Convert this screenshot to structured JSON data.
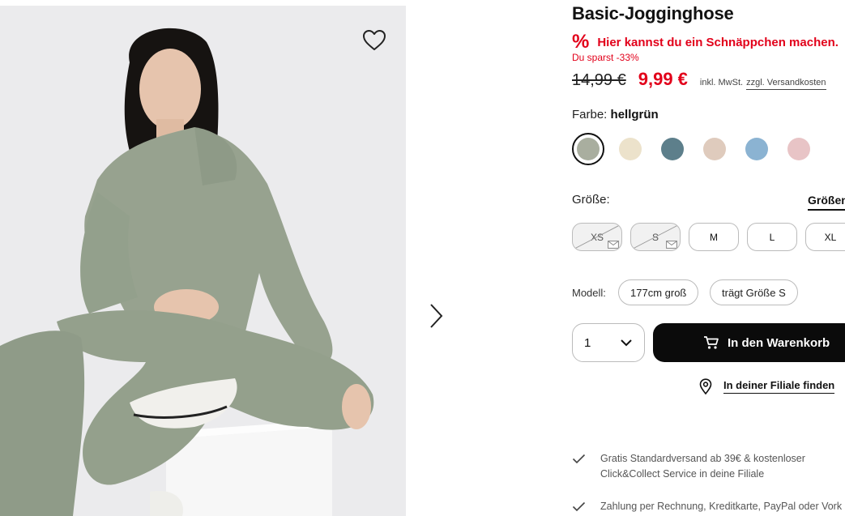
{
  "product": {
    "title": "Basic-Jogginghose",
    "deal_text": "Hier kannst du ein Schnäppchen machen.",
    "savings_text": "Du sparst -33%",
    "price_old": "14,99 €",
    "price_new": "9,99 €",
    "tax_note": "inkl. MwSt.",
    "shipping_link": "zzgl. Versandkosten"
  },
  "color": {
    "label": "Farbe:",
    "selected_name": "hellgrün",
    "swatches": [
      "#a9ae9f",
      "#ece2cb",
      "#5d7f8b",
      "#dfcbbd",
      "#8bb3d2",
      "#e8c4c6"
    ]
  },
  "size": {
    "label": "Größe:",
    "guide_link": "Größen",
    "options": [
      {
        "label": "XS",
        "available": false
      },
      {
        "label": "S",
        "available": false
      },
      {
        "label": "M",
        "available": true
      },
      {
        "label": "L",
        "available": true
      },
      {
        "label": "XL",
        "available": true
      }
    ]
  },
  "model": {
    "label": "Modell:",
    "height": "177cm groß",
    "wears": "trägt Größe S"
  },
  "purchase": {
    "quantity": "1",
    "cart_button": "In den Warenkorb",
    "store_finder": "In deiner Filiale finden"
  },
  "benefits": {
    "shipping_line1": "Gratis Standardversand ab 39€ & kostenloser",
    "shipping_line2": "Click&Collect Service in deine Filiale",
    "payment": "Zahlung per Rechnung, Kreditkarte, PayPal oder Vork"
  },
  "colors": {
    "accent": "#e2001a",
    "cart_bg": "#0b0b0b"
  }
}
